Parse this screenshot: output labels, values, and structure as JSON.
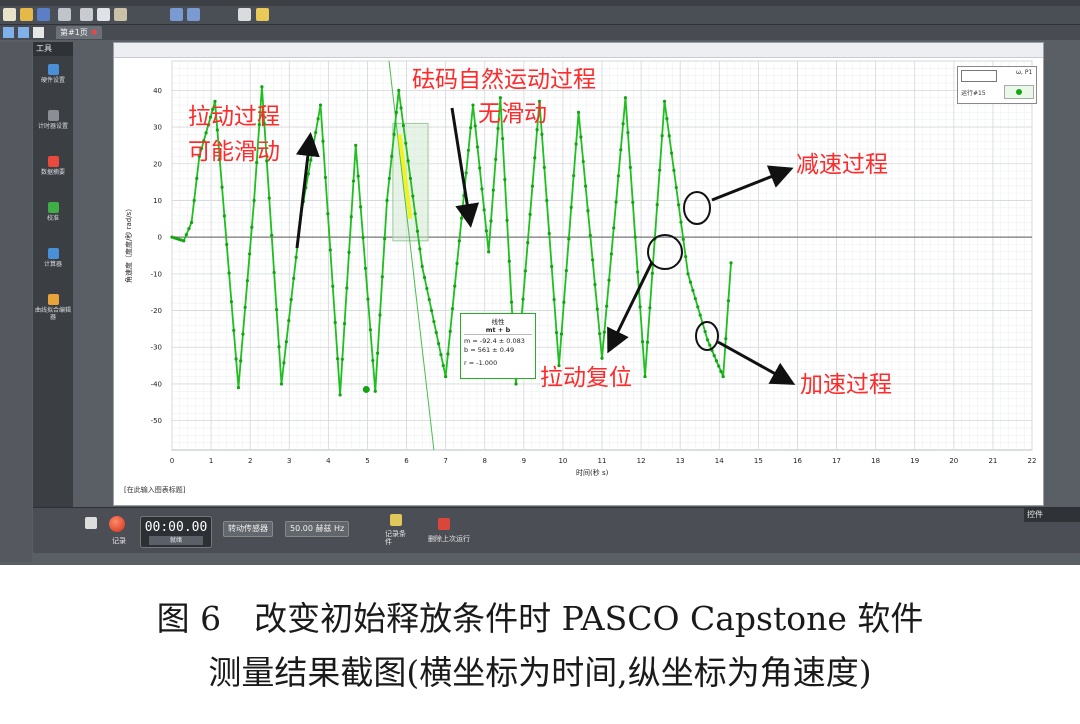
{
  "tab": {
    "label": "第#1页",
    "close": "✖"
  },
  "tools": {
    "header": "工具",
    "items": [
      {
        "label": "硬件设置",
        "color": "#4a90d9",
        "icon": "hardware-icon"
      },
      {
        "label": "计时器设置",
        "color": "#8a8f96",
        "icon": "timer-icon"
      },
      {
        "label": "数据摘要",
        "color": "#e84a3b",
        "icon": "data-summary-icon"
      },
      {
        "label": "校准",
        "color": "#3fae47",
        "icon": "calibration-icon"
      },
      {
        "label": "计算器",
        "color": "#4a90d9",
        "icon": "calculator-icon"
      },
      {
        "label": "曲线拟合编辑器",
        "color": "#e8a43b",
        "icon": "curve-fit-icon"
      }
    ]
  },
  "graph": {
    "ylabel": "角速度（度度/秒 rad/s）",
    "xlabel": "时间(秒 s)",
    "footnote": "[在此输入图表标题]",
    "legend": {
      "title": "ω, P1",
      "run": "运行#15"
    },
    "fit": {
      "title": "线性",
      "formula": "mt + b",
      "m": "m = -92.4 ± 0.083",
      "b": "b = 561   ± 0.49",
      "r": "r = -1.000"
    }
  },
  "annotations": {
    "drag_line1": "拉动过程",
    "drag_line2": "可能滑动",
    "natural_line1": "砝码自然运动过程",
    "natural_line2": "无滑动",
    "decel": "减速过程",
    "reset": "拉动复位",
    "accel": "加速过程"
  },
  "controls": {
    "record": "记录",
    "time": "00:00.00",
    "time_state": "就绪",
    "sensor": "转动传感器",
    "rate": "50.00 赫兹 Hz",
    "record_cond": "记录条件",
    "delete_last": "删除上次运行",
    "panel": "控件"
  },
  "caption": {
    "line1": "图 6　改变初始释放条件时 PASCO Capstone 软件",
    "line2": "测量结果截图(横坐标为时间,纵坐标为角速度)"
  },
  "chart_data": {
    "type": "line",
    "series": [
      {
        "x": [
          0,
          0.3,
          0.5,
          0.7,
          1.1,
          1.7,
          2.1,
          2.3,
          2.8,
          3.3,
          3.8,
          4.3,
          4.7,
          5.2,
          5.5,
          5.8,
          6.4,
          7.0,
          7.7,
          8.1,
          8.4,
          8.8,
          9.4,
          9.9,
          10.4,
          11.0,
          11.6,
          12.1,
          12.6,
          13.2,
          13.7,
          14.1,
          14.3
        ],
        "y": [
          0,
          -1,
          4,
          22,
          37,
          -41,
          10,
          41,
          -40,
          6,
          36,
          -43,
          25,
          -42,
          10,
          40,
          -8,
          -38,
          36,
          -4,
          38,
          -40,
          37,
          -35,
          34,
          -33,
          38,
          -38,
          37,
          -10,
          -28,
          -38,
          -7
        ]
      }
    ],
    "fit_line": {
      "m": -92.4,
      "b": 561
    },
    "xlim": [
      0,
      22
    ],
    "ylim": [
      -58,
      48
    ],
    "xticks": [
      0,
      1,
      2,
      3,
      4,
      5,
      6,
      7,
      8,
      9,
      10,
      11,
      12,
      13,
      14,
      15,
      16,
      17,
      18,
      19,
      20,
      21,
      22
    ],
    "yticks": [
      40,
      30,
      20,
      10,
      0,
      -10,
      -20,
      -30,
      -40,
      -50
    ],
    "grid": true,
    "legend": "top-right"
  }
}
